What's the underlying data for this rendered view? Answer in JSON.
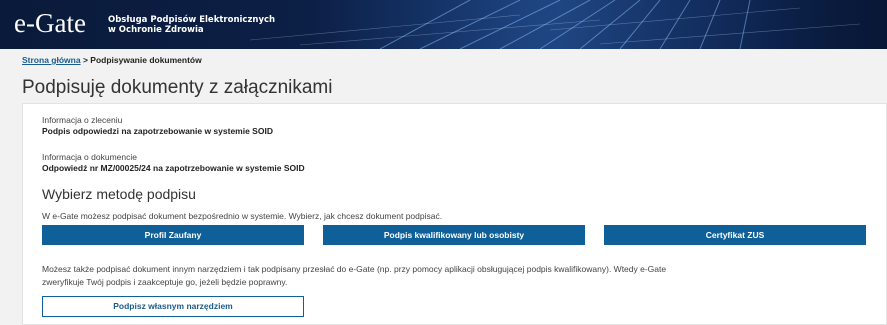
{
  "header": {
    "logo_text": "e-Gate",
    "tagline_line1": "Obsługa Podpisów Elektronicznych",
    "tagline_line2": "w Ochronie Zdrowia"
  },
  "breadcrumb": {
    "home_label": "Strona główna",
    "separator": ">",
    "current_label": "Podpisywanie dokumentów"
  },
  "page_title": "Podpisuję dokumenty z załącznikami",
  "order_info": {
    "label": "Informacja o zleceniu",
    "value": "Podpis odpowiedzi na zapotrzebowanie w systemie SOID"
  },
  "document_info": {
    "label": "Informacja o dokumencie",
    "value": "Odpowiedź nr MZ/00025/24 na zapotrzebowanie w systemie SOID"
  },
  "sign_method": {
    "title": "Wybierz metodę podpisu",
    "description": "W e-Gate możesz podpisać dokument bezpośrednio w systemie. Wybierz, jak chcesz dokument podpisać.",
    "buttons": [
      {
        "label": "Profil Zaufany"
      },
      {
        "label": "Podpis kwalifikowany lub osobisty"
      },
      {
        "label": "Certyfikat ZUS"
      }
    ],
    "alt_line1": "Możesz także podpisać dokument innym narzędziem i tak podpisany przesłać do e-Gate (np. przy pomocy aplikacji obsługującej podpis kwalifikowany). Wtedy e-Gate",
    "alt_line2": "zweryfikuje Twój podpis i zaakceptuje go, jeżeli będzie poprawny.",
    "own_tool_button": "Podpisz własnym narzędziem"
  },
  "colors": {
    "primary": "#0f5f98",
    "header_dark": "#0a1a3a",
    "link": "#1a5c8e"
  }
}
